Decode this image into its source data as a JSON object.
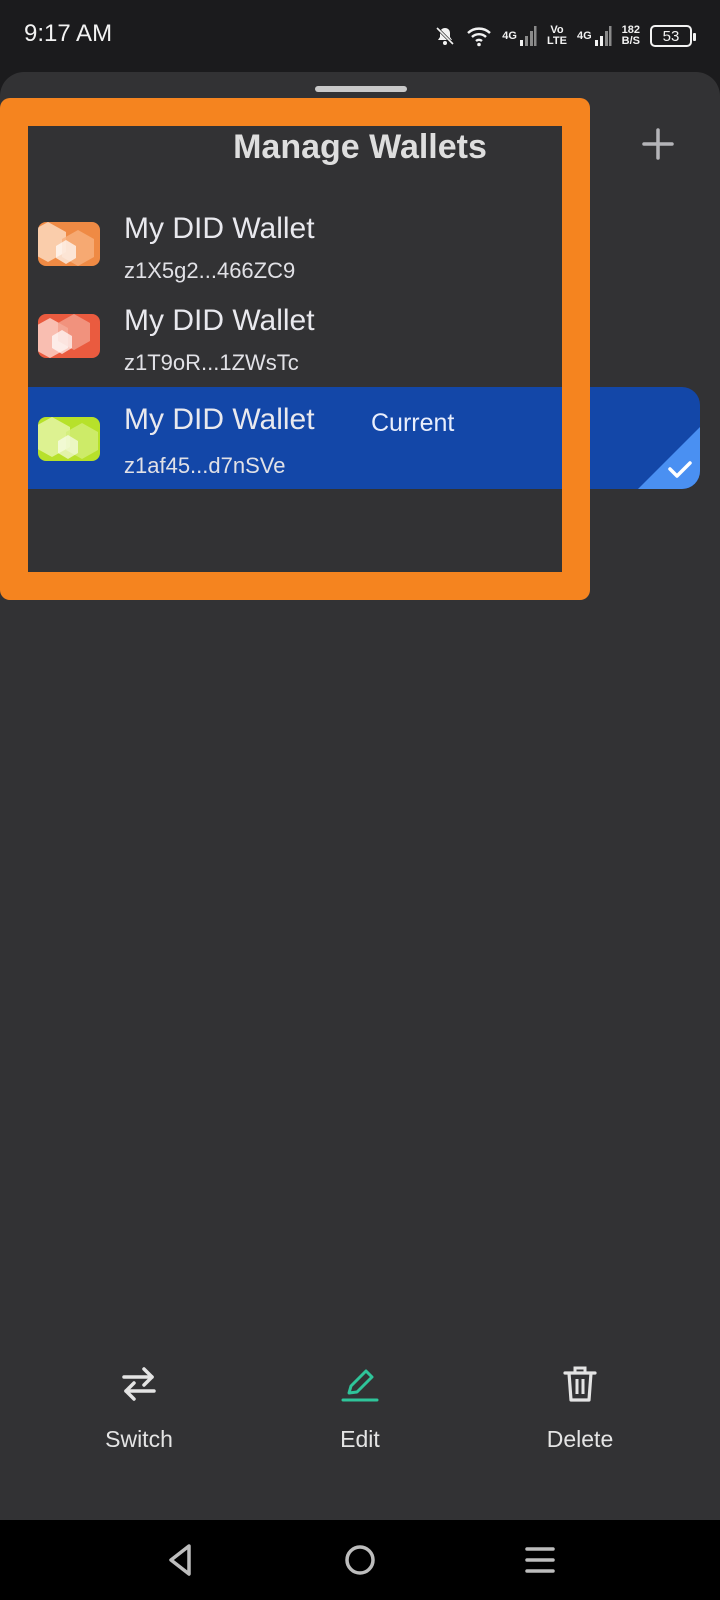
{
  "status_bar": {
    "time": "9:17 AM",
    "net_1": "4G",
    "net_2_top": "Vo",
    "net_2_bottom": "LTE",
    "net_3": "4G",
    "speed_value": "182",
    "speed_unit": "B/S",
    "battery": "53"
  },
  "sheet": {
    "title": "Manage Wallets",
    "add_icon": "plus-icon"
  },
  "wallets": [
    {
      "name": "My DID Wallet",
      "address": "z1X5g2...466ZC9",
      "color": "#ef8a44"
    },
    {
      "name": "My DID Wallet",
      "address": "z1T9oR...1ZWsTc",
      "color": "#ea5b3f"
    },
    {
      "name": "My DID Wallet",
      "address": "z1af45...d7nSVe",
      "color": "#b7e12a",
      "current_label": "Current"
    }
  ],
  "actions": {
    "switch_label": "Switch",
    "edit_label": "Edit",
    "delete_label": "Delete"
  },
  "colors": {
    "highlight": "#f5841f",
    "selected_row": "#1347a8",
    "edit_accent": "#2fc49a"
  }
}
